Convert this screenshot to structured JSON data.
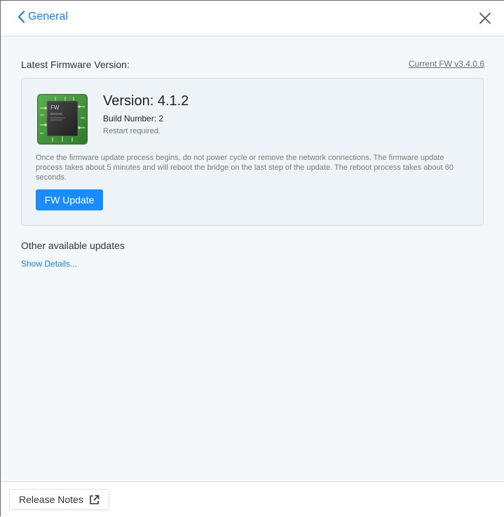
{
  "header": {
    "back_label": "General",
    "back_icon": "chevron-left-icon",
    "close_icon": "close-icon"
  },
  "firmware": {
    "latest_label": "Latest Firmware Version:",
    "current_fw": "Current FW v3.4.0.6",
    "chip_text": "FW",
    "chip_subtext": "BRIDGE",
    "version_title": "Version: 4.1.2",
    "build_number": "Build Number: 2",
    "restart_note": "Restart required.",
    "description": "Once the firmware update process begins, do not power cycle or remove the network connections. The firmware update process takes about 5 minutes and will reboot the bridge on the last step of the update. The reboot process takes about 60 seconds.",
    "update_button": "FW Update"
  },
  "other_updates": {
    "title": "Other available updates",
    "show_details": "Show Details..."
  },
  "footer": {
    "release_notes": "Release Notes",
    "release_notes_icon": "external-link-icon"
  },
  "colors": {
    "accent": "#1a8cff",
    "link": "#1a7fe0",
    "chip_green": "#3f8f3a"
  }
}
